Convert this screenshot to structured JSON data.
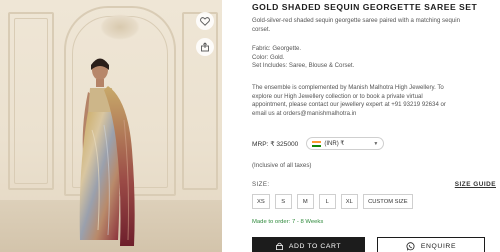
{
  "product": {
    "title": "GOLD SHADED SEQUIN GEORGETTE SAREE SET",
    "intro_line1": "Gold-silver-red shaded sequin georgette saree paired with a matching sequin",
    "intro_line2": "corset.",
    "details": [
      "Fabric: Georgette.",
      "Color: Gold.",
      "Set Includes: Saree, Blouse & Corset."
    ],
    "note_lines": [
      "The ensemble is complemented by Manish Malhotra High Jewellery. To",
      "explore our High Jewellery collection or to book a private virtual",
      "appointment, please contact our jewellery expert at +91 93219 92634 or",
      "email us at orders@manishmalhotra.in"
    ]
  },
  "price": {
    "mrp": "MRP: ₹ 325000",
    "currency": "(INR) ₹",
    "tax_note": "(Inclusive of all taxes)"
  },
  "size": {
    "label": "SIZE:",
    "guide": "SIZE GUIDE",
    "options": [
      "XS",
      "S",
      "M",
      "L",
      "XL",
      "CUSTOM SIZE"
    ]
  },
  "made_to_order": "Made to order: 7 - 8 Weeks",
  "actions": {
    "add_to_cart": "ADD TO CART",
    "enquire": "ENQUIRE"
  },
  "icons": {
    "wishlist": "heart-icon",
    "share": "share-icon",
    "cart": "lock-icon",
    "enquire": "whatsapp-icon",
    "currency_flag": "india-flag-icon"
  },
  "colors": {
    "accent_dark": "#1c1c1c",
    "made_to_order_green": "#2f8a3c"
  }
}
